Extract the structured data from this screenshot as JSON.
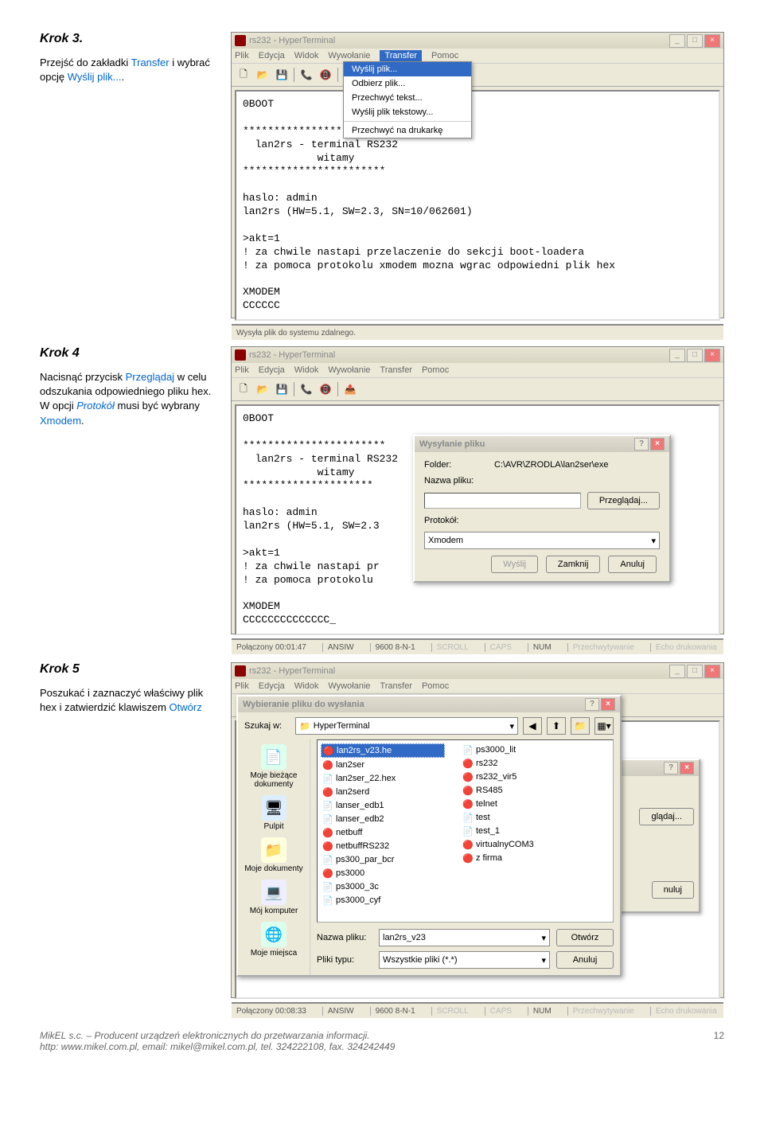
{
  "steps": {
    "s3": {
      "title": "Krok 3.",
      "desc_prefix": "Przejść do zakładki ",
      "desc_blue1": "Transfer",
      "desc_mid": " i wybrać opcję ",
      "desc_blue2": "Wyślij plik...",
      "desc_suffix": "."
    },
    "s4": {
      "title": "Krok 4",
      "desc_prefix": "Nacisnąć przycisk ",
      "desc_blue1": "Przeglądaj",
      "desc_mid1": " w celu odszukania odpowiedniego pliku hex. W opcji ",
      "desc_blue2": "Protokół",
      "desc_mid2": " musi być wybrany ",
      "desc_blue3": "Xmodem",
      "desc_suffix": "."
    },
    "s5": {
      "title": "Krok 5",
      "desc_prefix": "Poszukać i zaznaczyć właściwy plik hex i zatwierdzić klawiszem ",
      "desc_blue1": "Otwórz"
    }
  },
  "shot1": {
    "title": "rs232 - HyperTerminal",
    "menu": [
      "Plik",
      "Edycja",
      "Widok",
      "Wywołanie",
      "Transfer",
      "Pomoc"
    ],
    "menu_active": "Transfer",
    "dropdown": {
      "items": [
        "Wyślij plik...",
        "Odbierz plik...",
        "Przechwyć tekst...",
        "Wyślij plik tekstowy...",
        "Przechwyć na drukarkę"
      ],
      "selected": "Wyślij plik..."
    },
    "terminal": "0BOOT\n\n***********************\n  lan2rs - terminal RS232\n            witamy\n***********************\n\nhaslo: admin\nlan2rs (HW=5.1, SW=2.3, SN=10/062601)\n\n>akt=1\n! za chwile nastapi przelaczenie do sekcji boot-loadera\n! za pomoca protokolu xmodem mozna wgrac odpowiedni plik hex\n\nXMODEM\nCCCCCC",
    "status": "Wysyła plik do systemu zdalnego."
  },
  "shot2": {
    "title": "rs232 - HyperTerminal",
    "menu": [
      "Plik",
      "Edycja",
      "Widok",
      "Wywołanie",
      "Transfer",
      "Pomoc"
    ],
    "terminal": "0BOOT\n\n***********************\n  lan2rs - terminal RS232\n            witamy\n*********************\n\nhaslo: admin\nlan2rs (HW=5.1, SW=2.3\n\n>akt=1\n! za chwile nastapi pr\n! za pomoca protokolu\n\nXMODEM\nCCCCCCCCCCCCCC_",
    "dialog": {
      "title": "Wysyłanie pliku",
      "folder_label": "Folder:",
      "folder_value": "C:\\AVR\\ZRODLA\\lan2ser\\exe",
      "filename_label": "Nazwa pliku:",
      "protocol_label": "Protokół:",
      "protocol_value": "Xmodem",
      "btn_browse": "Przeglądaj...",
      "btn_send": "Wyślij",
      "btn_close": "Zamknij",
      "btn_cancel": "Anuluj"
    },
    "status": {
      "conn": "Połączony 00:01:47",
      "enc": "ANSIW",
      "rate": "9600 8-N-1",
      "scroll": "SCROLL",
      "caps": "CAPS",
      "num": "NUM",
      "cap": "Przechwytywanie",
      "echo": "Echo drukowania"
    }
  },
  "shot3": {
    "title": "rs232 - HyperTerminal",
    "menu": [
      "Plik",
      "Edycja",
      "Widok",
      "Wywołanie",
      "Transfer",
      "Pomoc"
    ],
    "shadow_dialog": {
      "btn_browse": "glądaj...",
      "btn_cancel": "nuluj"
    },
    "file_dialog": {
      "title": "Wybieranie pliku do wysłania",
      "lookin_label": "Szukaj w:",
      "lookin_value": "HyperTerminal",
      "places": [
        {
          "label": "Moje bieżące dokumenty",
          "glyph": "📄",
          "bg": "#dfe"
        },
        {
          "label": "Pulpit",
          "glyph": "🖥",
          "bg": "#def"
        },
        {
          "label": "Moje dokumenty",
          "glyph": "📁",
          "bg": "#ffd"
        },
        {
          "label": "Mój komputer",
          "glyph": "💻",
          "bg": "#eef"
        },
        {
          "label": "Moje miejsca",
          "glyph": "🌐",
          "bg": "#dfe"
        }
      ],
      "files_col1": [
        {
          "name": "lan2rs_v23.he",
          "icon": "🔴",
          "sel": true
        },
        {
          "name": "lan2ser",
          "icon": "🔴"
        },
        {
          "name": "lan2ser_22.hex",
          "icon": "📄"
        },
        {
          "name": "lan2serd",
          "icon": "🔴"
        },
        {
          "name": "lanser_edb1",
          "icon": "📄"
        },
        {
          "name": "lanser_edb2",
          "icon": "📄"
        },
        {
          "name": "netbuff",
          "icon": "🔴"
        },
        {
          "name": "netbuffRS232",
          "icon": "🔴"
        },
        {
          "name": "ps300_par_bcr",
          "icon": "📄"
        },
        {
          "name": "ps3000",
          "icon": "🔴"
        },
        {
          "name": "ps3000_3c",
          "icon": "📄"
        },
        {
          "name": "ps3000_cyf",
          "icon": "📄"
        },
        {
          "name": "ps3000_lit",
          "icon": "📄"
        },
        {
          "name": "rs232",
          "icon": "🔴"
        },
        {
          "name": "rs232_vir5",
          "icon": "🔴"
        }
      ],
      "files_col2": [
        {
          "name": "RS485",
          "icon": "🔴"
        },
        {
          "name": "telnet",
          "icon": "🔴"
        },
        {
          "name": "test",
          "icon": "📄"
        },
        {
          "name": "test_1",
          "icon": "📄"
        },
        {
          "name": "virtualnyCOM3",
          "icon": "🔴"
        },
        {
          "name": "z firma",
          "icon": "🔴"
        }
      ],
      "filename_label": "Nazwa pliku:",
      "filename_value": "lan2rs_v23",
      "filetype_label": "Pliki typu:",
      "filetype_value": "Wszystkie pliki (*.*)",
      "btn_open": "Otwórz",
      "btn_cancel": "Anuluj"
    },
    "status": {
      "conn": "Połączony 00:08:33",
      "enc": "ANSIW",
      "rate": "9600 8-N-1",
      "scroll": "SCROLL",
      "caps": "CAPS",
      "num": "NUM",
      "cap": "Przechwytywanie",
      "echo": "Echo drukowania"
    }
  },
  "footer": {
    "line1": "MikEL s.c. – Producent urządzeń elektronicznych do przetwarzania informacji.",
    "line2": "http: www.mikel.com.pl, email: mikel@mikel.com.pl, tel. 324222108, fax. 324242449",
    "page": "12"
  }
}
